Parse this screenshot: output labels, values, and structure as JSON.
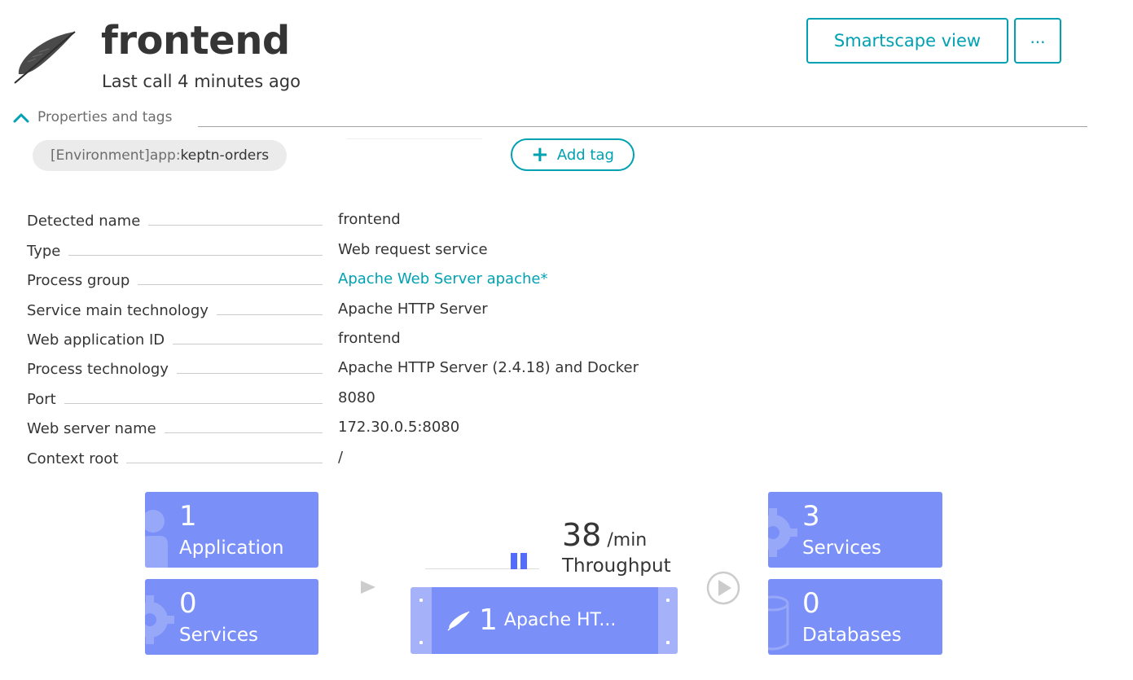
{
  "header": {
    "title": "frontend",
    "subtitle": "Last call 4 minutes ago",
    "smartscape_label": "Smartscape view",
    "more_label": "..."
  },
  "properties": {
    "toggle_label": "Properties and tags",
    "tag": {
      "key": "[Environment]app: ",
      "value": "keptn-orders"
    },
    "add_tag_label": "Add tag",
    "rows": [
      {
        "label": "Detected name",
        "value": "frontend"
      },
      {
        "label": "Type",
        "value": "Web request service"
      },
      {
        "label": "Process group",
        "value": "Apache Web Server apache*"
      },
      {
        "label": "Service main technology",
        "value": "Apache HTTP Server"
      },
      {
        "label": "Web application ID",
        "value": "frontend"
      },
      {
        "label": "Process technology",
        "value": "Apache HTTP Server (2.4.18) and Docker"
      },
      {
        "label": "Port",
        "value": "8080"
      },
      {
        "label": "Web server name",
        "value": "172.30.0.5:8080"
      },
      {
        "label": "Context root",
        "value": "/"
      }
    ]
  },
  "flow": {
    "callers": [
      {
        "count": "1",
        "label": "Application",
        "icon": "user-icon"
      },
      {
        "count": "0",
        "label": "Services",
        "icon": "gear-icon"
      }
    ],
    "callees": [
      {
        "count": "3",
        "label": "Services",
        "icon": "gear-icon"
      },
      {
        "count": "0",
        "label": "Databases",
        "icon": "database-icon"
      }
    ],
    "throughput": {
      "value": "38",
      "unit": " /min",
      "label": "Throughput"
    },
    "process": {
      "count": "1",
      "name": "Apache HT..."
    }
  },
  "colors": {
    "accent": "#00a1b2",
    "tile": "#7a8ff7",
    "tile_light": "#a5b2fa",
    "text": "#353535",
    "muted": "#6d6d6d"
  }
}
